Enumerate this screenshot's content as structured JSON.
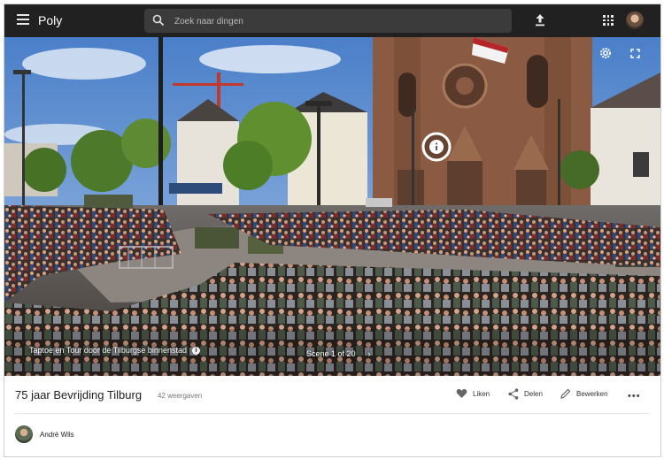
{
  "app": {
    "name": "Poly"
  },
  "search": {
    "placeholder": "Zoek naar dingen"
  },
  "viewer": {
    "caption": "Taptoe en Tour door de Tilburgse binnenstad",
    "scene_counter": "Scene 1 of 20"
  },
  "post": {
    "title": "75 jaar Bevrijding Tilburg",
    "views": "42 weergaven",
    "actions": {
      "like": "Liken",
      "share": "Delen",
      "edit": "Bewerken"
    },
    "author": "André Wils"
  },
  "icons": [
    "menu-icon",
    "search-icon",
    "upload-icon",
    "apps-icon",
    "avatar",
    "settings-icon",
    "fullscreen-icon",
    "info-icon",
    "heart-icon",
    "share-icon",
    "edit-icon",
    "more-icon"
  ]
}
